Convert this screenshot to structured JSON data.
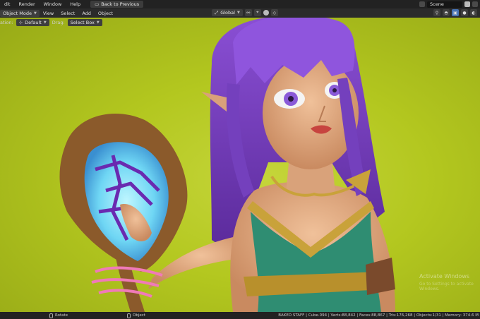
{
  "menubar": {
    "items": [
      "dit",
      "Render",
      "Window",
      "Help"
    ],
    "back_button": "Back to Previous",
    "scene": "Scene"
  },
  "header": {
    "mode": "Object Mode",
    "menus": [
      "View",
      "Select",
      "Add",
      "Object"
    ],
    "orientation": "Global"
  },
  "tool_settings": {
    "orientation_label": "ation:",
    "orientation_value": "Default",
    "drag_label": "Drag:",
    "drag_value": "Select Box"
  },
  "viewport": {
    "watermark_title": "Activate Windows",
    "watermark_sub": "Go to Settings to activate Windows."
  },
  "statusbar": {
    "hint_rotate": "Rotate",
    "hint_object": "Object",
    "stats": "BAKED STAFF | Cube.094 | Verts:88,842 | Faces:88,867 | Tris:176,268 | Objects:1/31 | Memory: 374.6 M"
  },
  "colors": {
    "background": "#b5c922",
    "hair": "#7b3fbf",
    "dress": "#2e8a6e",
    "crystal": "#7fe6ff",
    "staff": "#8b5a2b"
  }
}
